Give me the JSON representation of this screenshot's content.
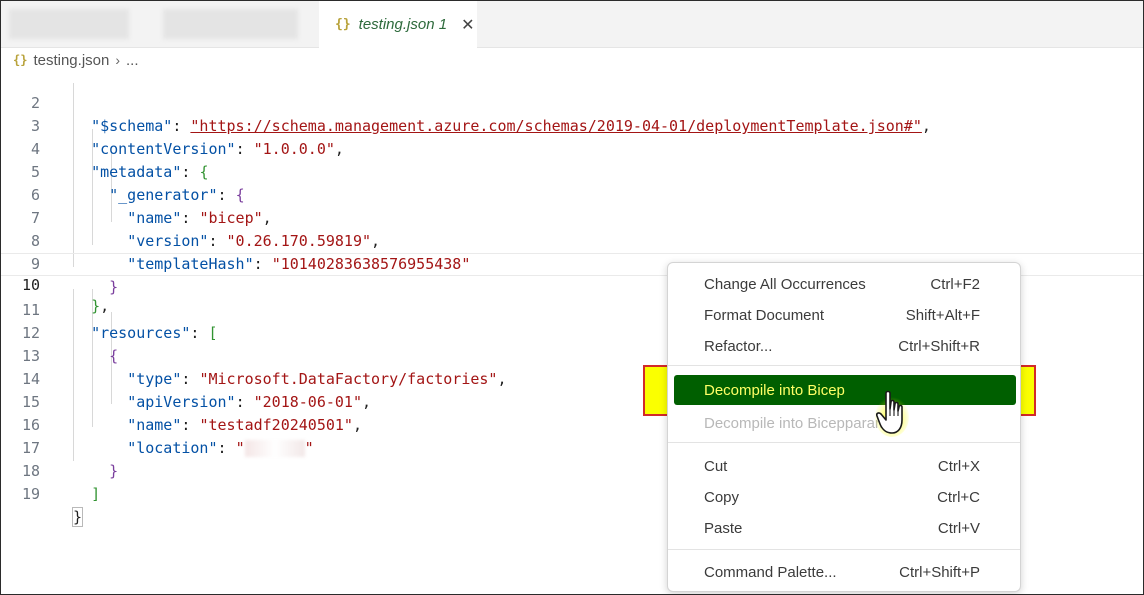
{
  "tabs": {
    "active": {
      "icon": "json-braces-icon",
      "glyph": "{}",
      "label": "testing.json",
      "problems": "1",
      "close": "✕"
    }
  },
  "breadcrumb": {
    "icon": "json-braces-icon",
    "glyph": "{}",
    "file": "testing.json",
    "separator": "›",
    "rest": "..."
  },
  "editor": {
    "current_line": 10,
    "lines": [
      {
        "n": "2"
      },
      {
        "n": "3"
      },
      {
        "n": "4"
      },
      {
        "n": "5"
      },
      {
        "n": "6"
      },
      {
        "n": "7"
      },
      {
        "n": "8"
      },
      {
        "n": "9"
      },
      {
        "n": "10"
      },
      {
        "n": "11"
      },
      {
        "n": "12"
      },
      {
        "n": "13"
      },
      {
        "n": "14"
      },
      {
        "n": "15"
      },
      {
        "n": "16"
      },
      {
        "n": "17"
      },
      {
        "n": "18"
      },
      {
        "n": "19"
      }
    ],
    "tokens": {
      "schema_key": "\"$schema\"",
      "schema_val": "\"https://schema.management.azure.com/schemas/2019-04-01/deploymentTemplate.json#\"",
      "cv_key": "\"contentVersion\"",
      "cv_val": "\"1.0.0.0\"",
      "metadata_key": "\"metadata\"",
      "generator_key": "\"_generator\"",
      "name_key": "\"name\"",
      "name_val": "\"bicep\"",
      "version_key": "\"version\"",
      "version_val": "\"0.26.170.59819\"",
      "hash_key": "\"templateHash\"",
      "hash_val": "\"10140283638576955438\"",
      "resources_key": "\"resources\"",
      "type_key": "\"type\"",
      "type_val": "\"Microsoft.DataFactory/factories\"",
      "api_key": "\"apiVersion\"",
      "api_val": "\"2018-06-01\"",
      "rname_key": "\"name\"",
      "rname_val": "\"testadf20240501\"",
      "loc_key": "\"location\"",
      "loc_open": "\"",
      "loc_close": "\""
    }
  },
  "context_menu": {
    "items": [
      {
        "label": "Change All Occurrences",
        "shortcut": "Ctrl+F2"
      },
      {
        "label": "Format Document",
        "shortcut": "Shift+Alt+F"
      },
      {
        "label": "Refactor...",
        "shortcut": "Ctrl+Shift+R"
      },
      {
        "label": "Decompile into Bicep",
        "shortcut": ""
      },
      {
        "label": "Decompile into Bicepparam",
        "shortcut": ""
      },
      {
        "label": "Cut",
        "shortcut": "Ctrl+X"
      },
      {
        "label": "Copy",
        "shortcut": "Ctrl+C"
      },
      {
        "label": "Paste",
        "shortcut": "Ctrl+V"
      },
      {
        "label": "Command Palette...",
        "shortcut": "Ctrl+Shift+P"
      }
    ],
    "highlight_color": "#005f00",
    "highlight_text_color": "#ffff66",
    "annotation_box_color": "#fbff00",
    "annotation_border_color": "#d22a2a"
  },
  "cursor": {
    "icon": "hand-pointer-icon"
  }
}
